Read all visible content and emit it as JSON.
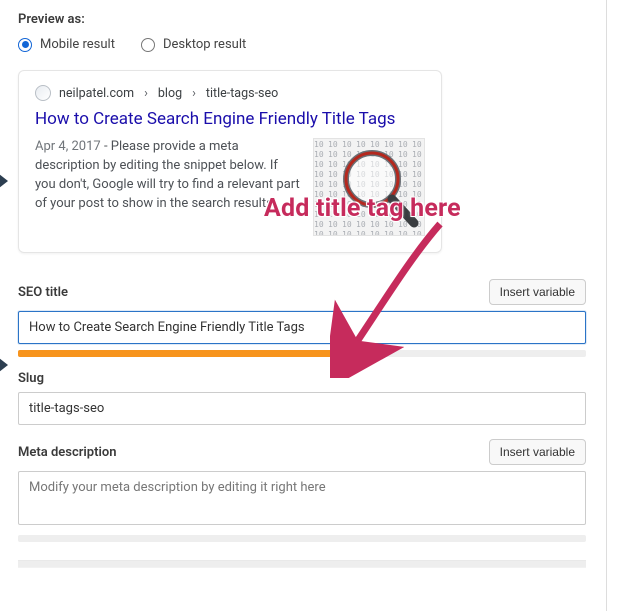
{
  "preview": {
    "label": "Preview as:",
    "options": {
      "mobile": "Mobile result",
      "desktop": "Desktop result"
    },
    "selected": "mobile"
  },
  "serp": {
    "breadcrumb": {
      "domain": "neilpatel.com",
      "p1": "blog",
      "p2": "title-tags-seo"
    },
    "title": "How to Create Search Engine Friendly Title Tags",
    "date": "Apr 4, 2017",
    "description_after_date": "Please provide a meta description by editing the snippet below. If you don't, Google will try to find a relevant part of your post to show in the search results."
  },
  "fields": {
    "seo_title": {
      "label": "SEO title",
      "value": "How to Create Search Engine Friendly Title Tags",
      "insert_variable": "Insert variable",
      "progress_percent": 62
    },
    "slug": {
      "label": "Slug",
      "value": "title-tags-seo"
    },
    "meta_description": {
      "label": "Meta description",
      "placeholder": "Modify your meta description by editing it right here",
      "insert_variable": "Insert variable",
      "progress_percent": 0
    }
  },
  "callout": {
    "text": "Add title tag here"
  },
  "colors": {
    "accent": "#f7941d",
    "callout": "#c62b5c",
    "link": "#1a0dab",
    "focus": "#2b74c7"
  }
}
